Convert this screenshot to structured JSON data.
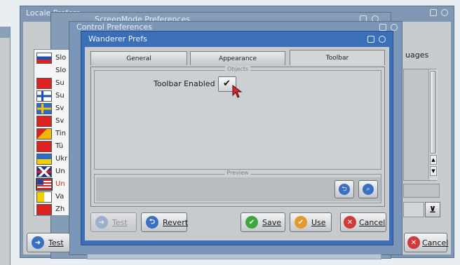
{
  "windows": {
    "locale": {
      "title": "Locale Prefere"
    },
    "screenmode": {
      "title": "ScreenMode Preferences"
    },
    "control": {
      "title": "Control Preferences"
    },
    "wanderer": {
      "title": "Wanderer Prefs"
    }
  },
  "languages": {
    "header": "uages",
    "items": [
      {
        "label": "Slo",
        "flag": "slovenia"
      },
      {
        "label": "Slo",
        "flag": "none"
      },
      {
        "label": "Su",
        "flag": "swiss"
      },
      {
        "label": "Su",
        "flag": "finland"
      },
      {
        "label": "Sv",
        "flag": "sweden"
      },
      {
        "label": "Sv",
        "flag": "swiss"
      },
      {
        "label": "Tin",
        "flag": "eritrea"
      },
      {
        "label": "Tü",
        "flag": "turkey"
      },
      {
        "label": "Ukr",
        "flag": "ukraine"
      },
      {
        "label": "Un",
        "flag": "uk"
      },
      {
        "label": "Un",
        "flag": "usa"
      },
      {
        "label": "Va",
        "flag": "vatican"
      },
      {
        "label": "Zh",
        "flag": "china"
      }
    ]
  },
  "tabs": {
    "general": "General",
    "appearance": "Appearance",
    "toolbar": "Toolbar"
  },
  "toolbar_tab": {
    "objects_legend": "Objects",
    "preview_legend": "Preview",
    "toolbar_enabled_label": "Toolbar Enabled",
    "toolbar_enabled_checked": true,
    "check_mark": "✔"
  },
  "buttons": {
    "test": "Test",
    "revert": "Revert",
    "save": "Save",
    "use": "Use",
    "cancel": "Cancel",
    "bg_test": "Test",
    "bg_cancel": "Cancel"
  },
  "colors": {
    "titlebar": "#6b86a8",
    "active_titlebar": "#3b6fb8",
    "save_icon": "#3fa63f",
    "use_icon": "#e39a2c",
    "cancel_icon": "#d03a3a",
    "revert_icon": "#3a6fc2"
  },
  "icons": {
    "save": "checkmark-icon",
    "use": "checkmark-icon",
    "cancel": "x-icon",
    "revert": "arrow-back-icon",
    "test": "arrow-icon",
    "dropdown": "chevron-down-icon"
  },
  "dropdown_glyph": "⊻"
}
